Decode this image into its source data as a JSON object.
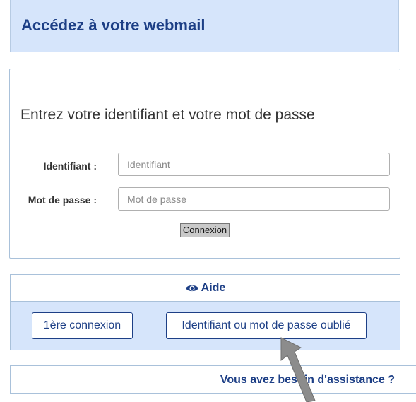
{
  "header": {
    "title": "Accédez à votre webmail"
  },
  "login": {
    "title": "Entrez votre identifiant et votre mot de passe",
    "username_label": "Identifiant :",
    "username_placeholder": "Identifiant",
    "username_value": "",
    "password_label": "Mot de passe :",
    "password_placeholder": "Mot de passe",
    "password_value": "",
    "submit_label": "Connexion"
  },
  "aide": {
    "title": "Aide",
    "icon": "eye-icon",
    "first_login_label": "1ère connexion",
    "forgot_label": "Identifiant ou mot de passe oublié"
  },
  "assistance": {
    "label": "Vous avez besoin d'assistance ?"
  },
  "colors": {
    "brand": "#1d3f86",
    "panel_background": "#d6e5fb"
  }
}
